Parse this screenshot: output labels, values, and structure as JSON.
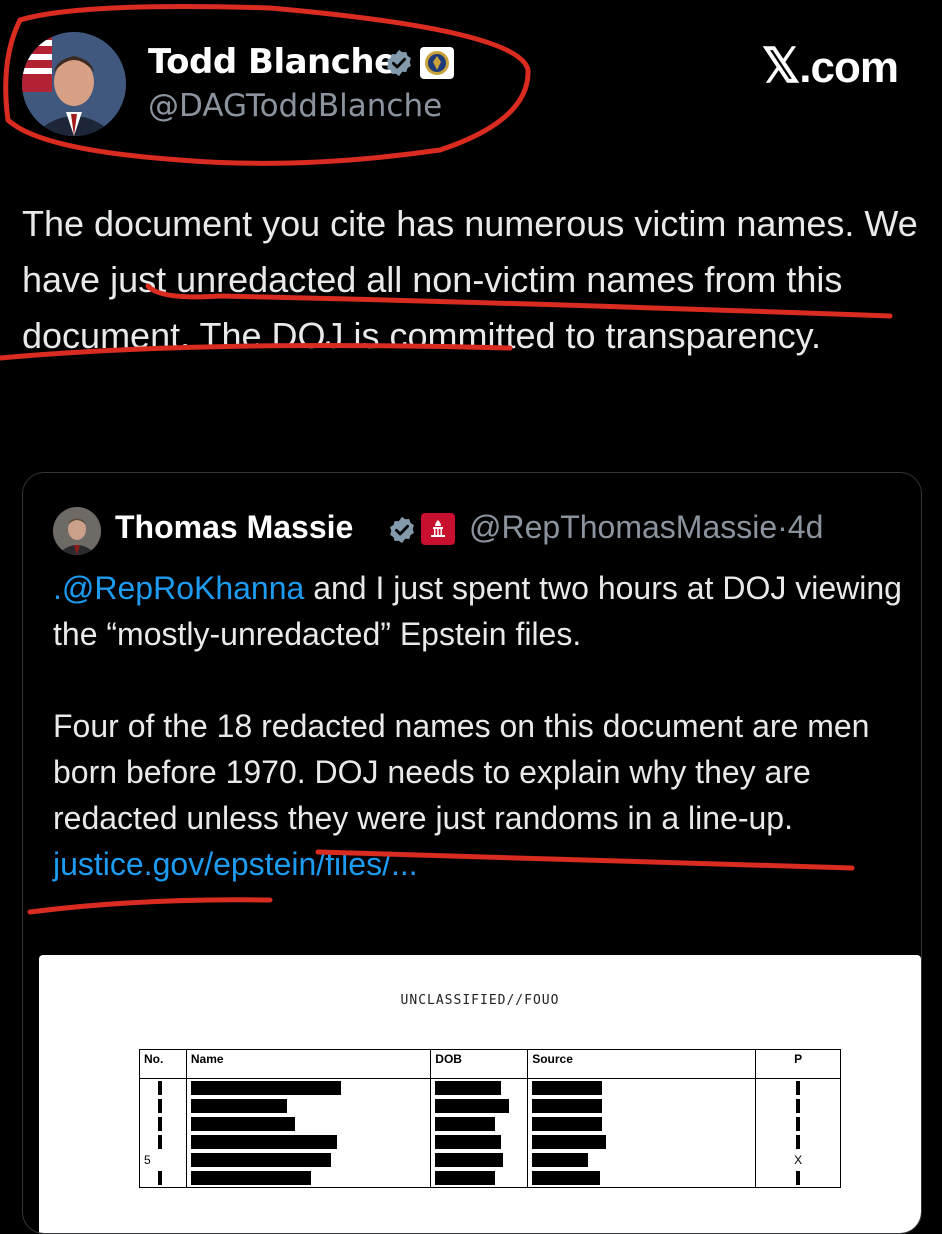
{
  "author": {
    "name": "Todd Blanche",
    "handle": "@DAGToddBlanche",
    "verified_color": "#829aab"
  },
  "brand": {
    "x": "𝕏",
    "label": ".com"
  },
  "tweet": {
    "text": "The document you cite has numerous victim names.  We have just unredacted all non-victim names from this document. The DOJ is committed to transparency."
  },
  "quote": {
    "name": "Thomas Massie",
    "handle": "@RepThomasMassie",
    "separator": "·",
    "age": "4d",
    "mention": ".@RepRoKhanna",
    "p1_rest": " and I just spent two hours at DOJ viewing the “mostly-unredacted” Epstein files.",
    "p2": "Four of the 18 redacted names on this document are men born before 1970. DOJ needs to explain why they are redacted unless they were just randoms in a line-up.",
    "link": "justice.gov/epstein/files/..."
  },
  "document": {
    "classification": "UNCLASSIFIED//FOUO",
    "headers": [
      "No.",
      "Name",
      "DOB",
      "Source",
      "P"
    ],
    "rows": [
      {
        "no": "",
        "p": ""
      },
      {
        "no": "",
        "p": ""
      },
      {
        "no": "",
        "p": ""
      },
      {
        "no": "",
        "p": ""
      },
      {
        "no": "5",
        "p": "X"
      },
      {
        "no": "",
        "p": ""
      }
    ]
  },
  "colors": {
    "background": "#000000",
    "text": "#e7e9ea",
    "muted": "#8b949e",
    "link": "#1d9bf0",
    "annotation": "#d92b1f"
  }
}
